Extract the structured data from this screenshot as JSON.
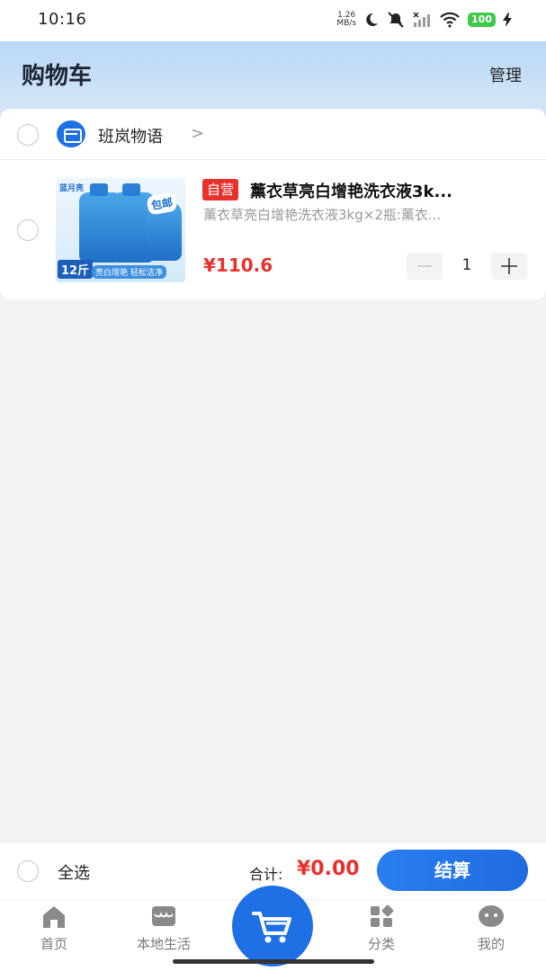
{
  "status_bar": {
    "time": "10:16",
    "net_speed_value": "1.26",
    "net_speed_unit": "MB/s",
    "battery": "100"
  },
  "header": {
    "title": "购物车",
    "manage_label": "管理"
  },
  "shop": {
    "name": "班岚物语",
    "chevron": ">"
  },
  "cart_item": {
    "tag": "自营",
    "title": "薰衣草亮白增艳洗衣液3k...",
    "spec": "薰衣草亮白增艳洗衣液3kg×2瓶:薰衣...",
    "price": "¥110.6",
    "quantity": "1",
    "image": {
      "brand_text": "蓝月亮",
      "badge": "包邮",
      "weight": "12斤",
      "caption": "亮白增艳 轻松洁净"
    }
  },
  "checkout": {
    "select_all_label": "全选",
    "total_label": "合计:",
    "total_value": "¥0.00",
    "button_label": "结算"
  },
  "tabbar": {
    "home": "首页",
    "local": "本地生活",
    "category": "分类",
    "mine": "我的"
  },
  "colors": {
    "accent": "#1f6fe5",
    "price": "#e8312d",
    "tag": "#e8312d"
  }
}
